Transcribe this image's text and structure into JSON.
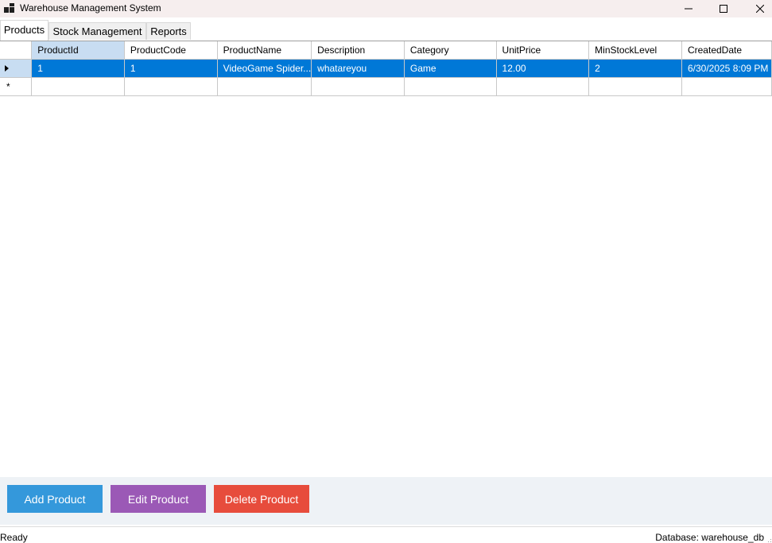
{
  "window": {
    "title": "Warehouse Management System",
    "controls": [
      "minimize-icon",
      "maximize-icon",
      "close-icon"
    ]
  },
  "tabs": [
    {
      "label": "Products",
      "active": true
    },
    {
      "label": "Stock Management",
      "active": false
    },
    {
      "label": "Reports",
      "active": false
    }
  ],
  "grid": {
    "columns": [
      "ProductId",
      "ProductCode",
      "ProductName",
      "Description",
      "Category",
      "UnitPrice",
      "MinStockLevel",
      "CreatedDate"
    ],
    "rows": [
      {
        "cells": [
          "1",
          "1",
          "VideoGame Spider...",
          "whatareyou",
          "Game",
          "12.00",
          "2",
          "6/30/2025 8:09 PM"
        ],
        "selected": true
      }
    ],
    "new_row_marker": "*"
  },
  "buttons": {
    "add": "Add Product",
    "edit": "Edit Product",
    "delete": "Delete Product"
  },
  "status": {
    "left": "Ready",
    "right": "Database: warehouse_db"
  },
  "colors": {
    "add_button": "#3498db",
    "edit_button": "#9b59b6",
    "delete_button": "#e74c3c",
    "selection": "#0078d7",
    "header_selected": "#c8ddf2"
  }
}
